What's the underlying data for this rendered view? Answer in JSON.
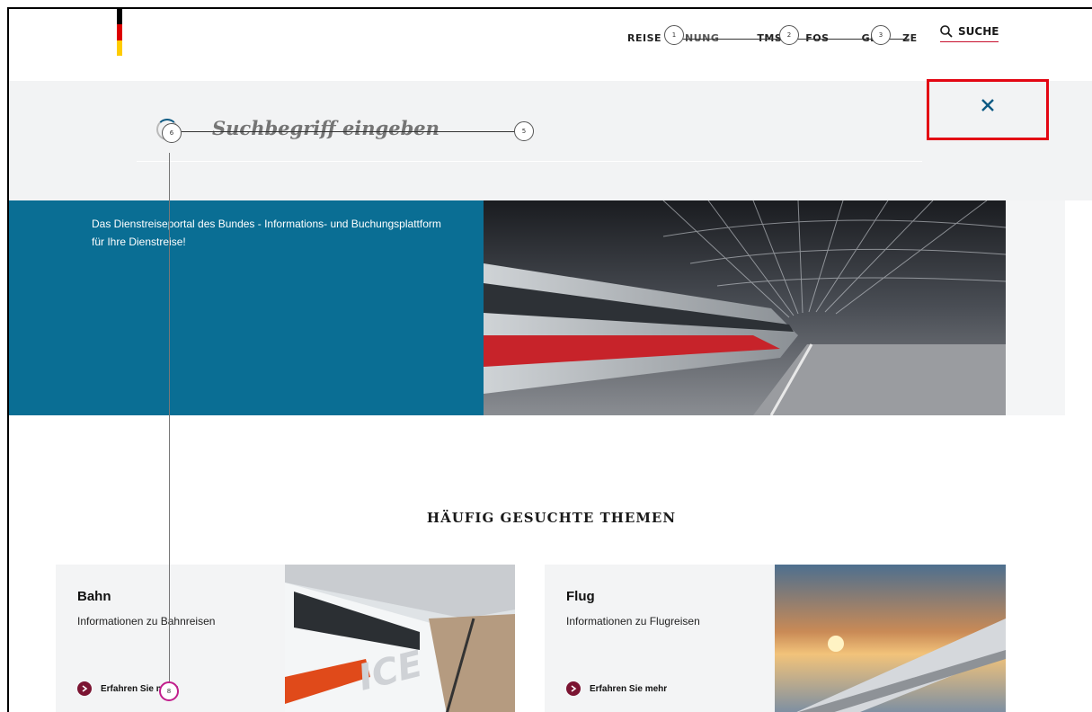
{
  "header": {
    "nav": [
      {
        "label": "REISE"
      },
      {
        "label": "NUNG"
      },
      {
        "label": "TMS"
      },
      {
        "label": "FOS"
      },
      {
        "label": "GE"
      },
      {
        "label": "ZE"
      }
    ],
    "search_label": "SUCHE"
  },
  "search": {
    "placeholder": "Suchbegriff eingeben"
  },
  "hero": {
    "text": "Das Dienstreiseportal des Bundes - Informations- und Buchungsplattform für Ihre Dienstreise!"
  },
  "section": {
    "title": "HÄUFIG GESUCHTE THEMEN"
  },
  "cards": [
    {
      "title": "Bahn",
      "desc": "Informationen zu Bahnreisen",
      "link": "Erfahren Sie mehr"
    },
    {
      "title": "Flug",
      "desc": "Informationen zu Flugreisen",
      "link": "Erfahren Sie mehr"
    }
  ],
  "markers": [
    "1",
    "2",
    "3",
    "5",
    "6",
    "8"
  ],
  "colors": {
    "brand_blue": "#0a6e94",
    "accent_red": "#e30613",
    "link_dot": "#7b1432",
    "panel_bg": "#f2f3f4"
  }
}
